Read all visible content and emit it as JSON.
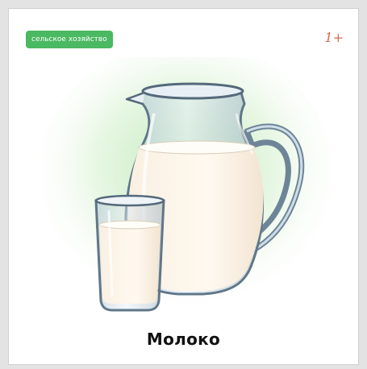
{
  "card": {
    "category_badge": "сельское хозяйство",
    "age_rating": "1+",
    "title": "Молоко"
  },
  "icons": {
    "illustration": "milk-jug-and-glass-illustration"
  },
  "colors": {
    "badge": "#4bb862",
    "age": "#d06a52",
    "glow": "#cfeec9"
  }
}
